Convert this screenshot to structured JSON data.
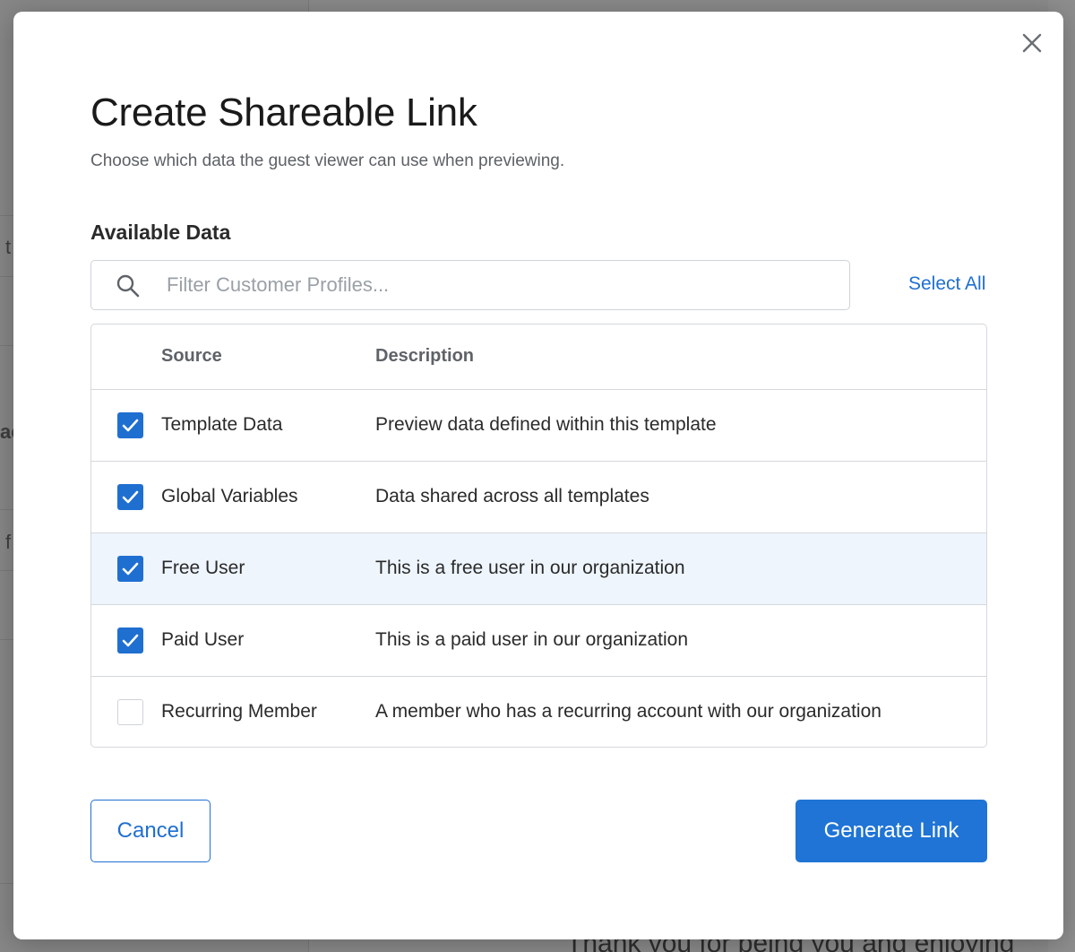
{
  "background": {
    "snippets": [
      "t",
      "ac",
      "f"
    ],
    "footer_text": "Thank you for being you and enjoying"
  },
  "modal": {
    "close_icon": "close-icon",
    "title": "Create Shareable Link",
    "subtitle": "Choose which data the guest viewer can use when previewing.",
    "section_label": "Available Data",
    "search": {
      "icon": "search-icon",
      "placeholder": "Filter Customer Profiles...",
      "value": ""
    },
    "select_all_label": "Select All",
    "table": {
      "headers": {
        "source": "Source",
        "description": "Description"
      },
      "rows": [
        {
          "source": "Template Data",
          "description": "Preview data defined within this template",
          "checked": true,
          "highlighted": false
        },
        {
          "source": "Global Variables",
          "description": "Data shared across all templates",
          "checked": true,
          "highlighted": false
        },
        {
          "source": "Free User",
          "description": "This is a free user in our organization",
          "checked": true,
          "highlighted": true
        },
        {
          "source": "Paid User",
          "description": "This is a paid user in our organization",
          "checked": true,
          "highlighted": false
        },
        {
          "source": "Recurring Member",
          "description": "A member who has a recurring account with our organization",
          "checked": false,
          "highlighted": false
        }
      ]
    },
    "cancel_label": "Cancel",
    "generate_label": "Generate Link"
  },
  "colors": {
    "accent": "#1f6fd1",
    "primary_button": "#1f74d6",
    "row_highlight": "#eef5fd",
    "overlay": "#7d7d7d"
  }
}
